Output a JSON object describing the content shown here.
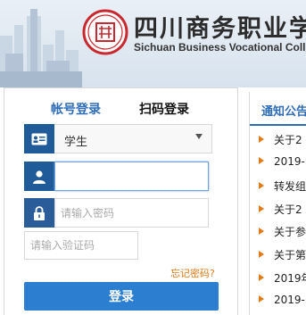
{
  "header": {
    "title_cn": "四川商务职业学院",
    "title_en": "Sichuan Business Vocational College",
    "logo_icon": "college-seal-logo",
    "colors": {
      "seal_red": "#c8282e"
    }
  },
  "login": {
    "tabs": [
      {
        "label": "帐号登录",
        "active": true
      },
      {
        "label": "扫码登录",
        "active": false
      }
    ],
    "role_select": {
      "value": "学生",
      "icon": "id-card-icon"
    },
    "username": {
      "value": "",
      "placeholder": "",
      "icon": "user-icon"
    },
    "password": {
      "value": "",
      "placeholder": "请输入密码",
      "icon": "lock-icon"
    },
    "captcha": {
      "value": "",
      "placeholder": "请输入验证码"
    },
    "forgot_label": "忘记密码?",
    "submit_label": "登录",
    "colors": {
      "primary": "#2b7ed0",
      "icon_bg": "#1f5a99",
      "accent": "#e07b1a"
    }
  },
  "notices": {
    "title": "通知公告",
    "items": [
      {
        "text": "关于2"
      },
      {
        "text": "2019-"
      },
      {
        "text": "转发组"
      },
      {
        "text": "关于2"
      },
      {
        "text": "关于参"
      },
      {
        "text": "关于第"
      },
      {
        "text": "2019年"
      },
      {
        "text": "2019-"
      }
    ]
  }
}
